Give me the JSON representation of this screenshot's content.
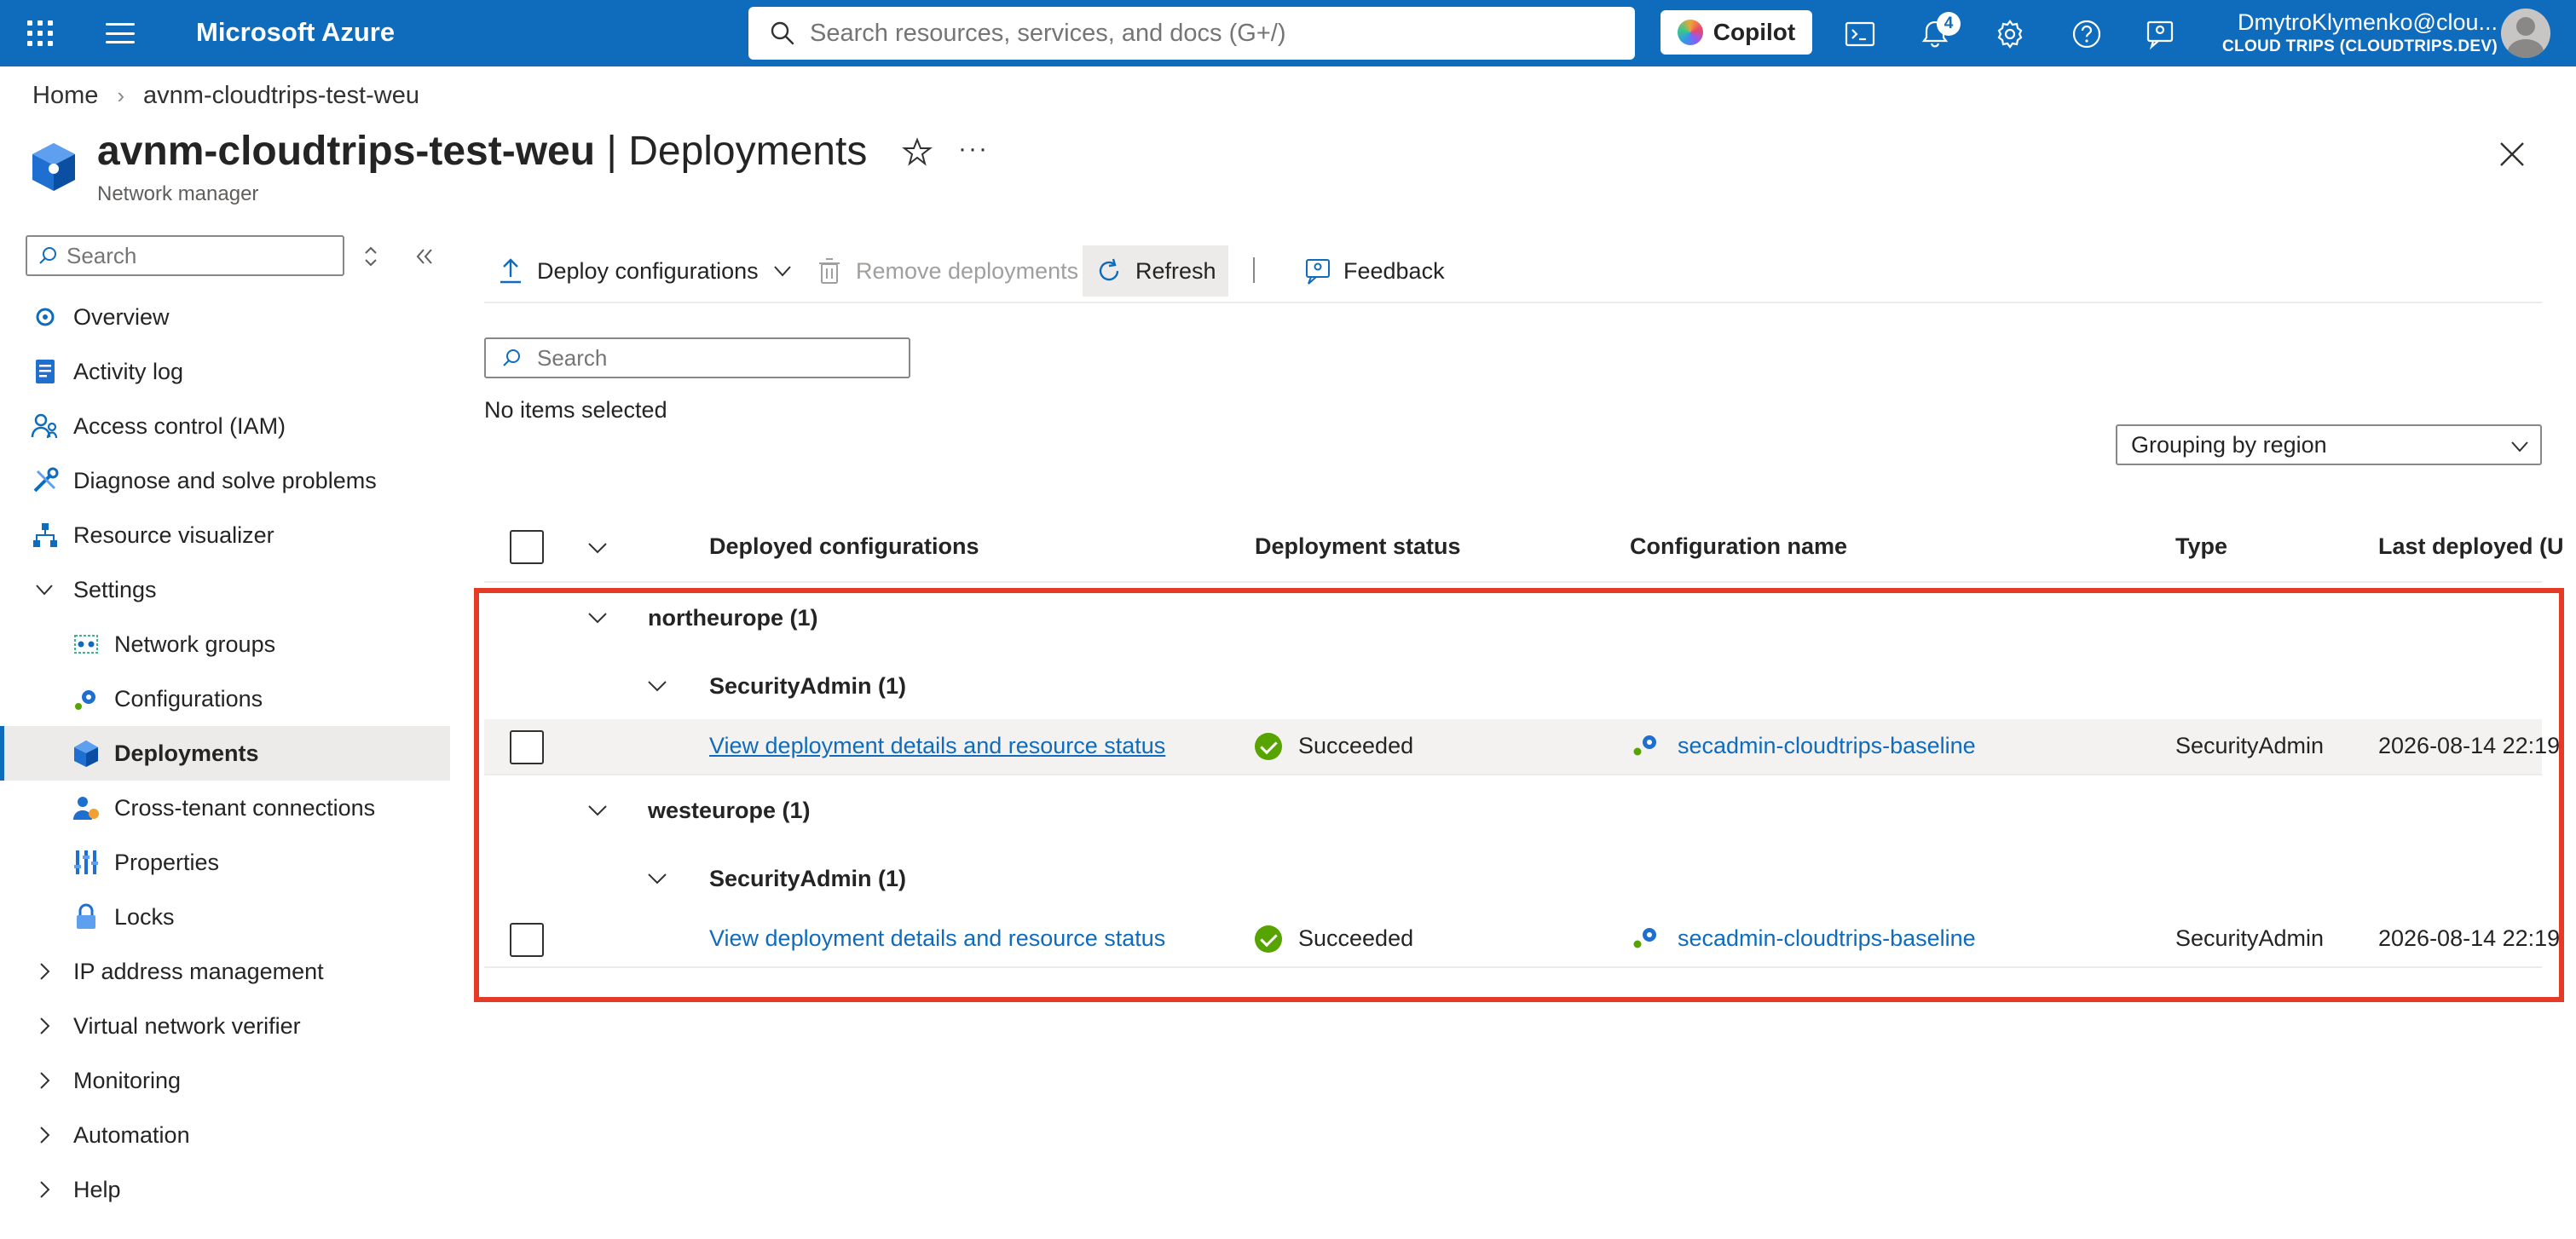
{
  "topbar": {
    "brand": "Microsoft Azure",
    "search_placeholder": "Search resources, services, and docs (G+/)",
    "copilot_label": "Copilot",
    "notification_count": "4",
    "user_name": "DmytroKlymenko@clou...",
    "tenant": "CLOUD TRIPS (CLOUDTRIPS.DEV)"
  },
  "breadcrumb": {
    "home": "Home",
    "current": "avnm-cloudtrips-test-weu"
  },
  "header": {
    "resource_name": "avnm-cloudtrips-test-weu",
    "page_suffix": " | Deployments",
    "subtitle": "Network manager"
  },
  "sidebar": {
    "search_placeholder": "Search",
    "items": [
      {
        "label": "Overview"
      },
      {
        "label": "Activity log"
      },
      {
        "label": "Access control (IAM)"
      },
      {
        "label": "Diagnose and solve problems"
      },
      {
        "label": "Resource visualizer"
      },
      {
        "label": "Settings"
      },
      {
        "label": "Network groups"
      },
      {
        "label": "Configurations"
      },
      {
        "label": "Deployments"
      },
      {
        "label": "Cross-tenant connections"
      },
      {
        "label": "Properties"
      },
      {
        "label": "Locks"
      },
      {
        "label": "IP address management"
      },
      {
        "label": "Virtual network verifier"
      },
      {
        "label": "Monitoring"
      },
      {
        "label": "Automation"
      },
      {
        "label": "Help"
      }
    ]
  },
  "toolbar": {
    "deploy": "Deploy configurations",
    "remove": "Remove deployments",
    "refresh": "Refresh",
    "feedback": "Feedback"
  },
  "content": {
    "search_placeholder": "Search",
    "selection_text": "No items selected",
    "grouping": "Grouping by region"
  },
  "table": {
    "columns": {
      "deployed": "Deployed configurations",
      "status": "Deployment status",
      "config": "Configuration name",
      "type": "Type",
      "last": "Last deployed (U"
    },
    "groups": [
      {
        "region": "northeurope (1)",
        "subgroup": "SecurityAdmin (1)",
        "row": {
          "link": "View deployment details and resource status",
          "status": "Succeeded",
          "config": "secadmin-cloudtrips-baseline",
          "type": "SecurityAdmin",
          "last": "2026-08-14 22:19"
        }
      },
      {
        "region": "westeurope (1)",
        "subgroup": "SecurityAdmin (1)",
        "row": {
          "link": "View deployment details and resource status",
          "status": "Succeeded",
          "config": "secadmin-cloudtrips-baseline",
          "type": "SecurityAdmin",
          "last": "2026-08-14 22:19"
        }
      }
    ]
  }
}
